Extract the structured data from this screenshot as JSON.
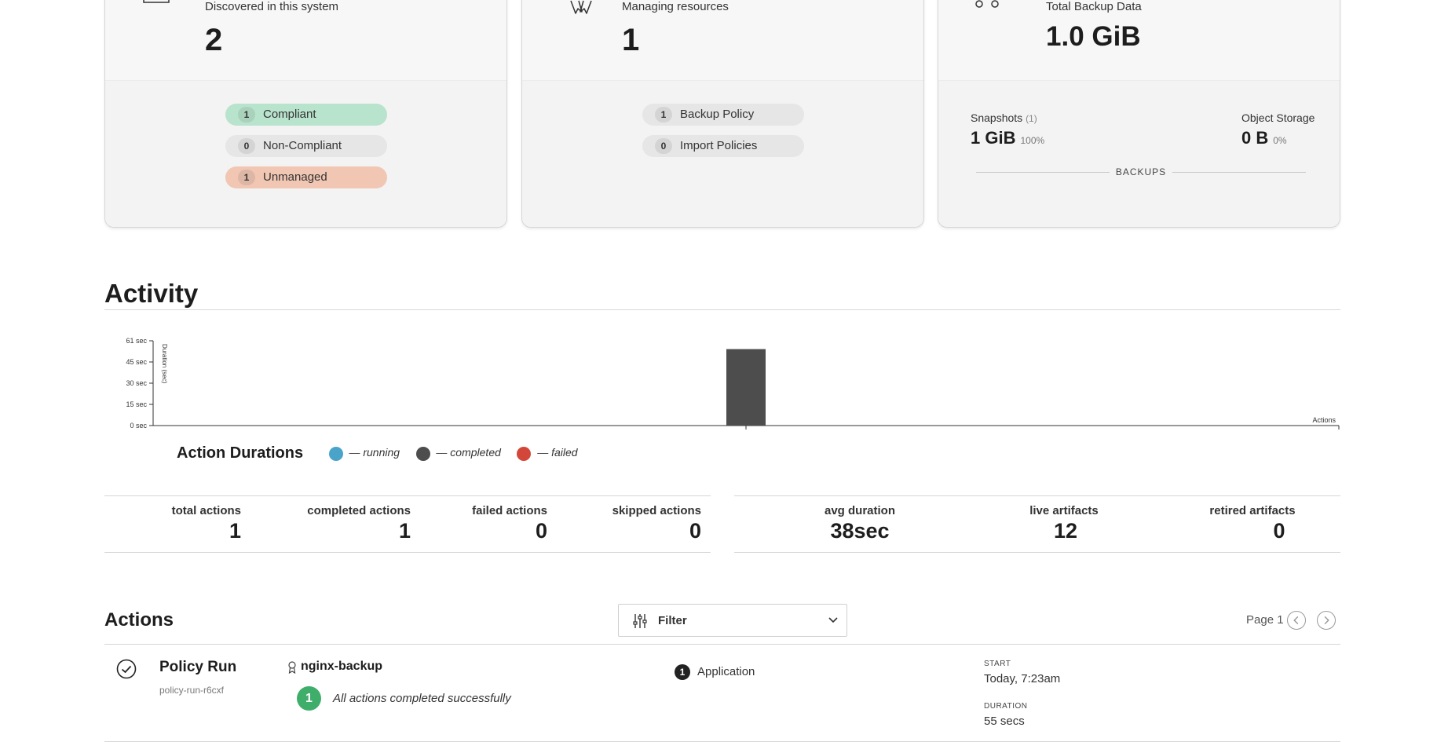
{
  "cards": [
    {
      "subtitle": "Discovered in this system",
      "value": "2",
      "icon": "application-icon",
      "pills": [
        {
          "count": "1",
          "label": "Compliant",
          "tone": "green"
        },
        {
          "count": "0",
          "label": "Non-Compliant",
          "tone": "gray"
        },
        {
          "count": "1",
          "label": "Unmanaged",
          "tone": "orange"
        }
      ]
    },
    {
      "subtitle": "Managing resources",
      "value": "1",
      "icon": "policy-ribbon-icon",
      "pills": [
        {
          "count": "1",
          "label": "Backup Policy",
          "tone": "gray"
        },
        {
          "count": "0",
          "label": "Import Policies",
          "tone": "gray"
        }
      ]
    },
    {
      "subtitle": "Total Backup Data",
      "value": "1.0 GiB",
      "icon": "data-nodes-icon",
      "backups_label": "BACKUPS",
      "snapshots": {
        "label": "Snapshots",
        "count": "(1)",
        "value": "1 GiB",
        "percent": "100%"
      },
      "object_storage": {
        "label": "Object Storage",
        "value": "0 B",
        "percent": "0%"
      }
    }
  ],
  "activity": {
    "title": "Activity"
  },
  "chart_data": {
    "type": "bar",
    "ylabel": "Duration (sec)",
    "xlabel": "Actions",
    "yticks": [
      "0 sec",
      "15 sec",
      "30 sec",
      "45 sec",
      "61 sec"
    ],
    "ylim": [
      0,
      61
    ],
    "series": [
      {
        "name": "completed",
        "x": [
          0.5
        ],
        "values": [
          55
        ]
      }
    ],
    "legend_title": "Action Durations",
    "legend": [
      {
        "label": "— running",
        "color": "#4aa3c9"
      },
      {
        "label": "— completed",
        "color": "#4d4d4d"
      },
      {
        "label": "— failed",
        "color": "#d2473a"
      }
    ]
  },
  "stats_left": [
    {
      "label": "total actions",
      "value": "1"
    },
    {
      "label": "completed actions",
      "value": "1"
    },
    {
      "label": "failed actions",
      "value": "0"
    },
    {
      "label": "skipped actions",
      "value": "0"
    }
  ],
  "stats_right": [
    {
      "label": "avg duration",
      "value": "38sec"
    },
    {
      "label": "live artifacts",
      "value": "12"
    },
    {
      "label": "retired artifacts",
      "value": "0"
    }
  ],
  "actions": {
    "title": "Actions",
    "filter_label": "Filter",
    "page_label": "Page 1",
    "rows": [
      {
        "title": "Policy Run",
        "id": "policy-run-r6cxf",
        "policy": "nginx-backup",
        "badge": "1",
        "message": "All actions completed successfully",
        "app_count": "1",
        "app_label": "Application",
        "start_label": "START",
        "start_value": "Today, 7:23am",
        "duration_label": "DURATION",
        "duration_value": "55 secs"
      }
    ]
  },
  "colors": {
    "compliant": "#b8e3cd",
    "unmanaged": "#f1c6b3",
    "neutral_pill": "#e6e6e6",
    "success": "#3fae6a",
    "bar_completed": "#4d4d4d"
  }
}
